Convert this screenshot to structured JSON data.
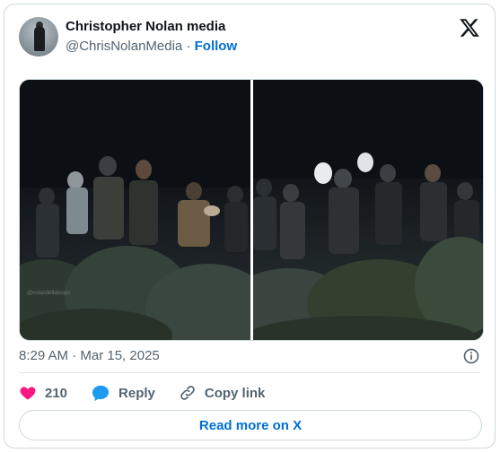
{
  "author": {
    "name": "Christopher Nolan media",
    "handle": "@ChrisNolanMedia",
    "separator": "·",
    "follow_label": "Follow"
  },
  "brand": {
    "logo_icon": "x-logo-icon"
  },
  "media": {
    "photos": [
      {
        "name": "photo-left",
        "watermark": "@nolandeltaloops"
      },
      {
        "name": "photo-right"
      }
    ]
  },
  "meta": {
    "timestamp": "8:29 AM · Mar 15, 2025",
    "info_icon": "info-icon"
  },
  "actions": {
    "like_count": "210",
    "reply_label": "Reply",
    "copy_link_label": "Copy link"
  },
  "read_more_label": "Read more on X",
  "colors": {
    "like": "#f91880",
    "reply": "#1d9bf0",
    "link": "#006fd6",
    "muted": "#536471",
    "border": "#cfd9de"
  }
}
